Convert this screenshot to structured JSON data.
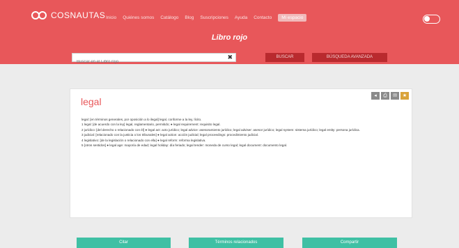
{
  "header": {
    "logo_text": "COSNAUTAS",
    "nav": [
      "Inicio",
      "Quiénes somos",
      "Catálogo",
      "Blog",
      "Suscripciones",
      "Ayuda",
      "Contacto"
    ],
    "account_label": "Mi espacio",
    "page_title": "Libro rojo"
  },
  "search": {
    "placeholder": "Buscar en el Libro rojo",
    "clear_symbol": "✖",
    "search_button": "BUSCAR",
    "advanced_button": "BÚSQUEDA AVANZADA"
  },
  "entry": {
    "term": "legal",
    "tools": [
      "◂",
      "⎙",
      "✉",
      "★"
    ],
    "definition_lead": "legal:",
    "definition_lines": [
      "legal: [en términos generales, por oposición a lo ilegal] legal, conforme a la ley, lícito.",
      "1 legal: [de acuerdo con la ley] legal, reglamentario, permitido; ● legal requirement: requisito legal.",
      "2 jurídico: [del derecho o relacionado con él] ● legal act: acto jurídico; legal advice: asesoramiento jurídico; legal adviser: asesor jurídico; legal system: sistema jurídico; legal entity: persona jurídica.",
      "3 judicial: [relacionado con la justicia o los tribunales] ● legal action: acción judicial; legal proceedings: procedimiento judicial.",
      "4 legislativo: [de la legislación o relacionado con ella] ● legal reform: reforma legislativa.",
      "5 [otros sentidos] ● legal age: mayoría de edad; legal holiday: día feriado; legal tender: moneda de curso legal; legal document: documento legal."
    ]
  },
  "actions": [
    "Citar",
    "Términos relacionados",
    "Compartir"
  ]
}
